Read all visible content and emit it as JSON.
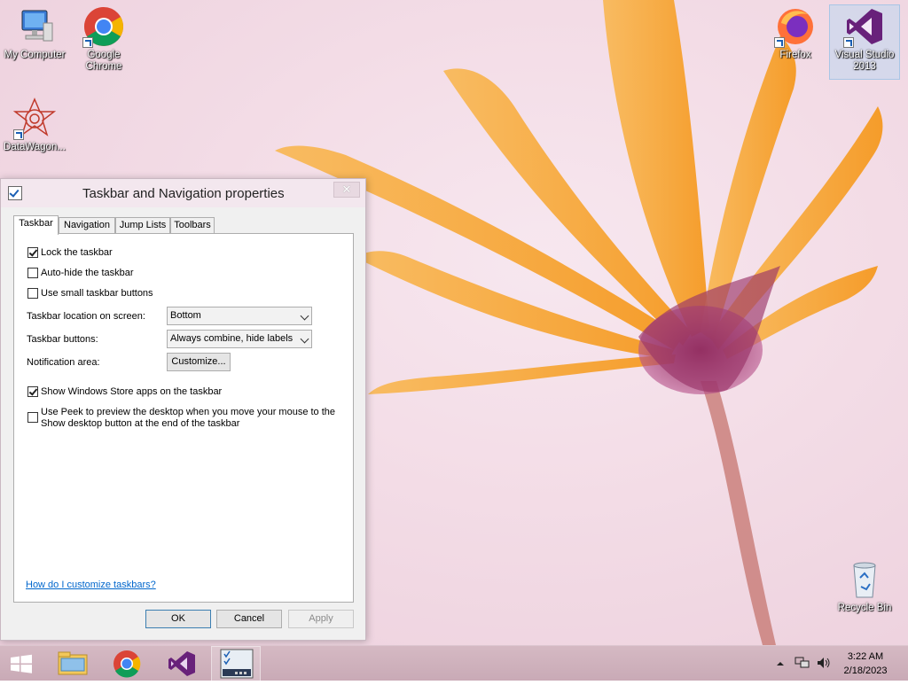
{
  "desktop": {
    "icons": [
      {
        "label": "My Computer"
      },
      {
        "label": "Google Chrome"
      },
      {
        "label": "DataWagon..."
      },
      {
        "label": "Firefox"
      },
      {
        "label": "Visual Studio 2013"
      },
      {
        "label": "Recycle Bin"
      }
    ]
  },
  "dialog": {
    "title": "Taskbar and Navigation properties",
    "close_glyph": "✕",
    "tabs": [
      {
        "label": "Taskbar",
        "active": true
      },
      {
        "label": "Navigation"
      },
      {
        "label": "Jump Lists"
      },
      {
        "label": "Toolbars"
      }
    ],
    "options": {
      "lock_taskbar": {
        "label": "Lock the taskbar",
        "checked": true
      },
      "auto_hide": {
        "label": "Auto-hide the taskbar",
        "checked": false
      },
      "small_buttons": {
        "label": "Use small taskbar buttons",
        "checked": false
      },
      "store_apps": {
        "label": "Show Windows Store apps on the taskbar",
        "checked": true
      },
      "peek_line1": "Use Peek to preview the desktop when you move your mouse to the",
      "peek_line2": "Show desktop button at the end of the taskbar",
      "peek_checked": false
    },
    "location": {
      "label": "Taskbar location on screen:",
      "value": "Bottom"
    },
    "buttons_setting": {
      "label": "Taskbar buttons:",
      "value": "Always combine, hide labels"
    },
    "notification": {
      "label": "Notification area:",
      "button": "Customize..."
    },
    "help_link": "How do I customize taskbars?",
    "footer": {
      "ok": "OK",
      "cancel": "Cancel",
      "apply": "Apply"
    }
  },
  "taskbar": {
    "items": [
      {
        "icon": "windows-start-icon"
      },
      {
        "icon": "file-explorer-icon"
      },
      {
        "icon": "chrome-icon"
      },
      {
        "icon": "visual-studio-icon"
      },
      {
        "icon": "taskbar-properties-icon",
        "active": true
      }
    ],
    "time": "3:22 AM",
    "date": "2/18/2023"
  },
  "colors": {
    "link": "#0066cc",
    "flower": "#f5a623",
    "vs_purple": "#68217a"
  }
}
